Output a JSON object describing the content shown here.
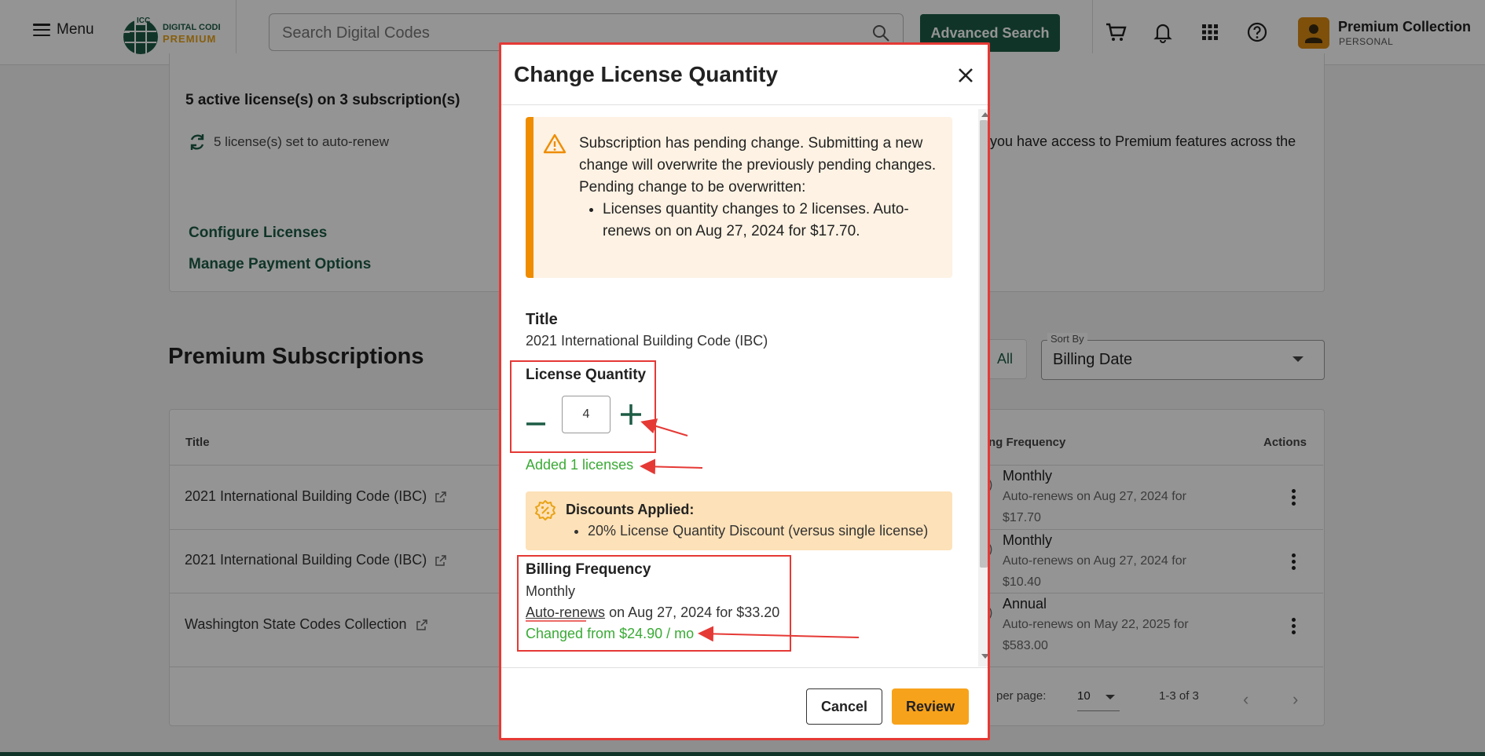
{
  "header": {
    "menu_label": "Menu",
    "logo": {
      "top": "ICC",
      "line1": "DIGITAL CODES",
      "line2": "PREMIUM"
    },
    "search_placeholder": "Search Digital Codes",
    "advanced_search_label": "Advanced Search",
    "icons": [
      "cart-icon",
      "bell-icon",
      "apps-grid-icon",
      "help-icon"
    ],
    "account": {
      "name": "Premium Collection",
      "type": "PERSONAL"
    }
  },
  "summary": {
    "active_text": "5 active license(s) on 3 subscription(s)",
    "auto_renew_text": "5 license(s) set to auto-renew",
    "configure_link": "Configure Licenses",
    "payment_link": "Manage Payment Options",
    "premium_note": "you have access to Premium features across the"
  },
  "subscriptions": {
    "section_title": "Premium Subscriptions",
    "filter_all_label": "All",
    "sort_by_label": "Sort By",
    "sort_by_value": "Billing Date",
    "columns": {
      "title": "Title",
      "frequency": "ng Frequency",
      "actions": "Actions"
    },
    "rows": [
      {
        "title": "2021 International Building Code (IBC)",
        "frequency": "Monthly",
        "renew": "Auto-renews on Aug 27, 2024 for $17.70"
      },
      {
        "title": "2021 International Building Code (IBC)",
        "frequency": "Monthly",
        "renew": "Auto-renews on Aug 27, 2024 for $10.40"
      },
      {
        "title": "Washington State Codes Collection",
        "frequency": "Annual",
        "renew": "Auto-renews on May 22, 2025 for $583.00"
      }
    ],
    "pagination": {
      "rows_label": "per page:",
      "rows_value": "10",
      "range": "1-3 of 3"
    }
  },
  "modal": {
    "title": "Change License Quantity",
    "warning": {
      "line1": "Subscription has pending change. Submitting a new change will overwrite the previously pending changes.",
      "line2": "Pending change to be overwritten:",
      "item": "Licenses quantity changes to 2 licenses. Auto-renews on on Aug 27, 2024 for $17.70."
    },
    "title_label": "Title",
    "title_value": "2021 International Building Code (IBC)",
    "quantity_label": "License Quantity",
    "quantity_value": "4",
    "added_note": "Added 1 licenses",
    "discounts": {
      "title": "Discounts Applied:",
      "items": [
        "20% License Quantity Discount (versus single license)"
      ]
    },
    "billing": {
      "label": "Billing Frequency",
      "value": "Monthly",
      "auto_renews_link": "Auto-renews",
      "renew_rest": " on Aug 27, 2024 for $33.20",
      "changed_note": "Changed from $24.90 / mo"
    },
    "cancel_label": "Cancel",
    "review_label": "Review"
  },
  "colors": {
    "brand_green": "#1d5c45",
    "review_orange": "#f7a21b",
    "warning_orange": "#ef8c00",
    "success_green": "#3aaa35",
    "annotation_red": "#e53935"
  }
}
